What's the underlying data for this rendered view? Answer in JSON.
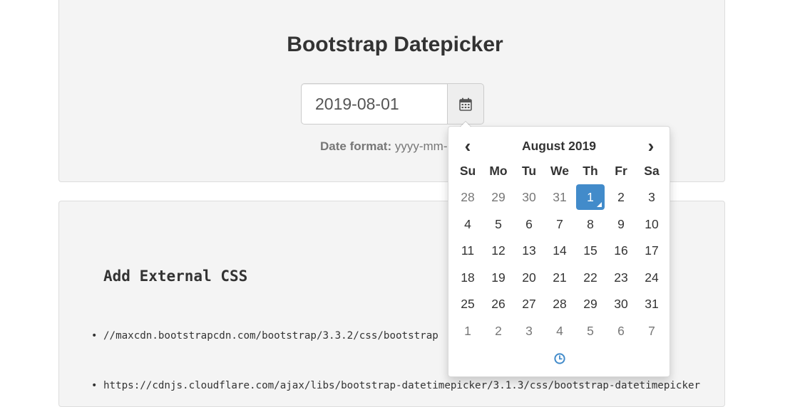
{
  "header": {
    "title": "Bootstrap Datepicker"
  },
  "date_field": {
    "value": "2019-08-01",
    "addon_icon": "calendar-icon"
  },
  "format_hint": {
    "label": "Date format:",
    "value": "yyyy-mm-"
  },
  "section": {
    "heading": "Add External CSS",
    "links": [
      "//maxcdn.bootstrapcdn.com/bootstrap/3.3.2/css/bootstrap",
      "https://cdnjs.cloudflare.com/ajax/libs/bootstrap-datetimepicker/3.1.3/css/bootstrap-datetimepicker"
    ]
  },
  "datepicker": {
    "month_label": "August 2019",
    "prev_label": "‹",
    "next_label": "›",
    "weekdays": [
      "Su",
      "Mo",
      "Tu",
      "We",
      "Th",
      "Fr",
      "Sa"
    ],
    "weeks": [
      [
        "28",
        "29",
        "30",
        "31",
        "1",
        "2",
        "3"
      ],
      [
        "4",
        "5",
        "6",
        "7",
        "8",
        "9",
        "10"
      ],
      [
        "11",
        "12",
        "13",
        "14",
        "15",
        "16",
        "17"
      ],
      [
        "18",
        "19",
        "20",
        "21",
        "22",
        "23",
        "24"
      ],
      [
        "25",
        "26",
        "27",
        "28",
        "29",
        "30",
        "31"
      ],
      [
        "1",
        "2",
        "3",
        "4",
        "5",
        "6",
        "7"
      ]
    ],
    "muted_days": [
      [
        0,
        0
      ],
      [
        0,
        1
      ],
      [
        0,
        2
      ],
      [
        0,
        3
      ],
      [
        5,
        0
      ],
      [
        5,
        1
      ],
      [
        5,
        2
      ],
      [
        5,
        3
      ],
      [
        5,
        4
      ],
      [
        5,
        5
      ],
      [
        5,
        6
      ]
    ],
    "selected_day": [
      0,
      4
    ],
    "toggle_icon": "clock-icon",
    "accent_color": "#428bca"
  }
}
